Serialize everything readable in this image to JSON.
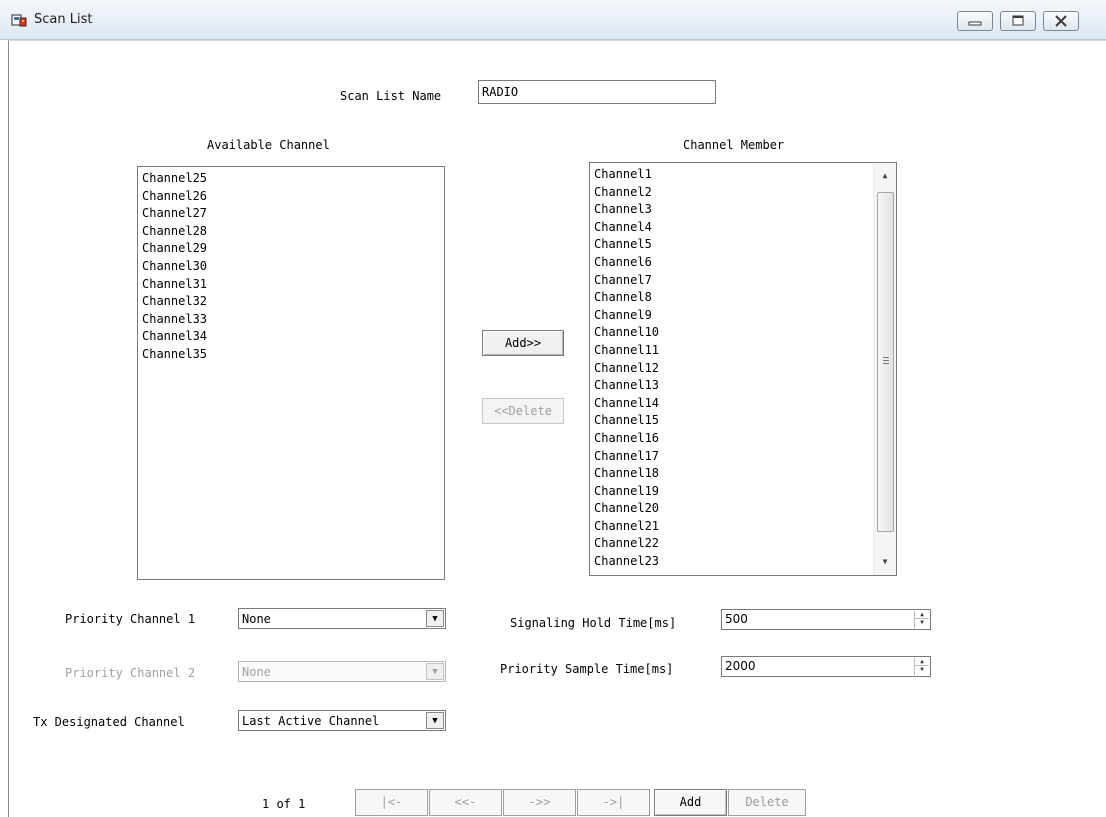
{
  "window": {
    "title": "Scan List",
    "icon": "radio-app-icon",
    "controls": [
      "minimize",
      "restore",
      "close"
    ]
  },
  "form": {
    "scan_list_name_label": "Scan List Name",
    "scan_list_name_value": "RADIO",
    "available_channel_header": "Available Channel",
    "channel_member_header": "Channel Member",
    "available_channels": [
      "Channel25",
      "Channel26",
      "Channel27",
      "Channel28",
      "Channel29",
      "Channel30",
      "Channel31",
      "Channel32",
      "Channel33",
      "Channel34",
      "Channel35"
    ],
    "member_channels": [
      "Channel1",
      "Channel2",
      "Channel3",
      "Channel4",
      "Channel5",
      "Channel6",
      "Channel7",
      "Channel8",
      "Channel9",
      "Channel10",
      "Channel11",
      "Channel12",
      "Channel13",
      "Channel14",
      "Channel15",
      "Channel16",
      "Channel17",
      "Channel18",
      "Channel19",
      "Channel20",
      "Channel21",
      "Channel22",
      "Channel23"
    ],
    "add_button": "Add>>",
    "delete_button": "<<Delete",
    "priority1_label": "Priority Channel 1",
    "priority1_value": "None",
    "priority2_label": "Priority Channel 2",
    "priority2_value": "None",
    "tx_label": "Tx Designated Channel",
    "tx_value": "Last Active Channel",
    "hold_time_label": "Signaling Hold Time[ms]",
    "hold_time_value": "500",
    "sample_time_label": "Priority Sample Time[ms]",
    "sample_time_value": "2000"
  },
  "pager": {
    "page_text": "1 of 1",
    "first": "|<-",
    "prev": "<<-",
    "next": "->>",
    "last": "->|",
    "add": "Add",
    "delete": "Delete"
  }
}
